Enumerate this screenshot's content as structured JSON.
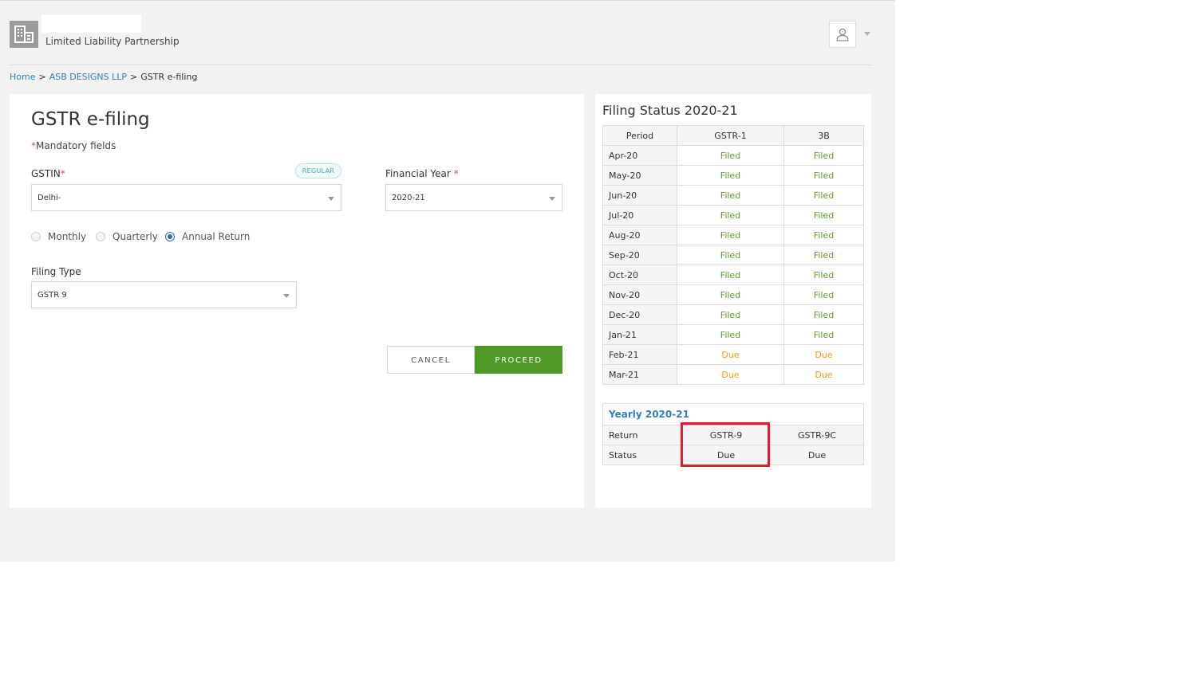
{
  "header": {
    "org_type": "Limited Liability Partnership",
    "icons": {
      "org": "building-icon",
      "user": "user-icon",
      "menu": "chevron-down-icon"
    }
  },
  "breadcrumb": {
    "home": "Home",
    "company": "ASB DESIGNS LLP",
    "current": "GSTR e-filing",
    "separator": ">"
  },
  "form": {
    "title": "GSTR e-filing",
    "mandatory_asterisk": "*",
    "mandatory_text": "Mandatory fields",
    "gstin_label": "GSTIN",
    "required_mark": "*",
    "gstin_badge": "REGULAR",
    "gstin_value": "Delhi-",
    "fy_label": "Financial Year",
    "fy_value": "2020-21",
    "radios": [
      {
        "label": "Monthly",
        "selected": false
      },
      {
        "label": "Quarterly",
        "selected": false
      },
      {
        "label": "Annual Return",
        "selected": true
      }
    ],
    "filing_type_label": "Filing Type",
    "filing_type_value": "GSTR 9",
    "cancel_label": "CANCEL",
    "proceed_label": "PROCEED"
  },
  "status": {
    "title": "Filing Status 2020-21",
    "columns": [
      "Period",
      "GSTR-1",
      "3B"
    ],
    "rows": [
      {
        "period": "Apr-20",
        "gstr1": "Filed",
        "b3": "Filed"
      },
      {
        "period": "May-20",
        "gstr1": "Filed",
        "b3": "Filed"
      },
      {
        "period": "Jun-20",
        "gstr1": "Filed",
        "b3": "Filed"
      },
      {
        "period": "Jul-20",
        "gstr1": "Filed",
        "b3": "Filed"
      },
      {
        "period": "Aug-20",
        "gstr1": "Filed",
        "b3": "Filed"
      },
      {
        "period": "Sep-20",
        "gstr1": "Filed",
        "b3": "Filed"
      },
      {
        "period": "Oct-20",
        "gstr1": "Filed",
        "b3": "Filed"
      },
      {
        "period": "Nov-20",
        "gstr1": "Filed",
        "b3": "Filed"
      },
      {
        "period": "Dec-20",
        "gstr1": "Filed",
        "b3": "Filed"
      },
      {
        "period": "Jan-21",
        "gstr1": "Filed",
        "b3": "Filed"
      },
      {
        "period": "Feb-21",
        "gstr1": "Due",
        "b3": "Due"
      },
      {
        "period": "Mar-21",
        "gstr1": "Due",
        "b3": "Due"
      }
    ],
    "status_colors": {
      "Filed": "#5d9b29",
      "Due": "#f39c12"
    }
  },
  "yearly": {
    "title": "Yearly 2020-21",
    "return_label": "Return",
    "status_label": "Status",
    "returns": [
      "GSTR-9",
      "GSTR-9C"
    ],
    "statuses": [
      "Due",
      "Due"
    ]
  },
  "colors": {
    "accent": "#2f7fc1",
    "proceed": "#4f9a26",
    "highlight": "#e01e2b"
  }
}
